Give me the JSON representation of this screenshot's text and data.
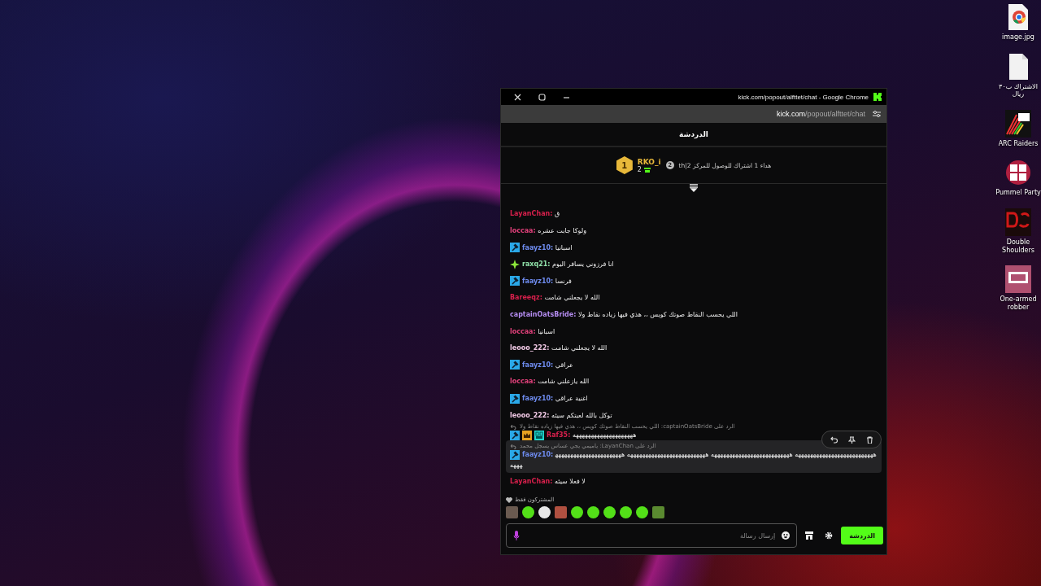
{
  "desktop_icons": [
    {
      "kind": "chrome-file",
      "label": "image.jpg"
    },
    {
      "kind": "blank-file",
      "label": "الاشتراك ب٣٠ ريال"
    },
    {
      "kind": "arc",
      "label": "ARC Raiders"
    },
    {
      "kind": "pummel",
      "label": "Pummel Party"
    },
    {
      "kind": "ds",
      "label": "Double Shoulders"
    },
    {
      "kind": "oar",
      "label": "One-armed robber"
    }
  ],
  "window": {
    "title": "kick.com/popout/alfttet/chat - Google Chrome",
    "url_host": "kick.com",
    "url_path": "/popout/alfttet/chat"
  },
  "chat": {
    "title": "الدردشة",
    "top_gifter": {
      "rank": "1",
      "name": "RKO_i",
      "gifts": "2",
      "next_rank_badge": "2",
      "next_rank_text": "th|هداء 1 اشتراك للوصول للمركز 2"
    },
    "messages": [
      {
        "user": "LayanChan:",
        "color": "#d8204c",
        "text": "ق",
        "highlighted": false
      },
      {
        "user": "loccaa:",
        "color": "#e0407a",
        "text": "ولوكا جابت عشره",
        "highlighted": false
      },
      {
        "user": "faayz10:",
        "color": "#6f8cf0",
        "badges": [
          {
            "kind": "mod"
          }
        ],
        "text": "اسبانيا",
        "highlighted": false
      },
      {
        "user": "raxq21:",
        "color": "#8fe0a8",
        "badges": [
          {
            "kind": "sparkle"
          }
        ],
        "text": "انا فرزوني يسافر اليوم",
        "highlighted": false
      },
      {
        "user": "faayz10:",
        "color": "#6f8cf0",
        "badges": [
          {
            "kind": "mod"
          }
        ],
        "text": "فرنسا",
        "highlighted": false
      },
      {
        "user": "Bareeqz:",
        "color": "#d8204c",
        "text": "الله لا يجعلني شامت",
        "highlighted": false
      },
      {
        "user": "captainOatsBride:",
        "color": "#b48cf0",
        "text": "اللي يحسب النقاط صوتك كويس ،، هذي فيها زياده نقاط ولا",
        "highlighted": false
      },
      {
        "user": "loccaa:",
        "color": "#e0407a",
        "text": "اسبانيا",
        "highlighted": false
      },
      {
        "user": "leooo_222:",
        "color": "#f0c8e4",
        "text": "الله لا يجعلني شامت",
        "highlighted": false
      },
      {
        "user": "faayz10:",
        "color": "#6f8cf0",
        "badges": [
          {
            "kind": "mod"
          }
        ],
        "text": "عراقي",
        "highlighted": false
      },
      {
        "user": "loccaa:",
        "color": "#e0407a",
        "text": "الله يازعلني شامت",
        "highlighted": false
      },
      {
        "user": "faayz10:",
        "color": "#6f8cf0",
        "badges": [
          {
            "kind": "mod"
          }
        ],
        "text": "اغنية عراقي",
        "highlighted": false
      },
      {
        "user": "leooo_222:",
        "color": "#f0c8e4",
        "text": "توكل بالله لعبتكم سيئه",
        "highlighted": false
      },
      {
        "user": "Raf35:",
        "color": "#d8204c",
        "badges": [
          {
            "kind": "mod"
          },
          {
            "kind": "crown"
          },
          {
            "kind": "og"
          }
        ],
        "reply_to": "الرد على captainOatsBride: اللي يحسب النقاط صوتك كويس ،، هذي فيها زياده نقاط ولا",
        "text": "ههههههههههههههههههههه",
        "highlighted": false
      },
      {
        "user": "faayz10:",
        "color": "#6f8cf0",
        "badges": [
          {
            "kind": "mod"
          }
        ],
        "reply_to": "الرد على LayanChan: ياميمي يجي عساس يسجل محمد",
        "text": "ههههههههههههههههههههههههههه ههههههههههههههههههههههههههه ههههههههههههههههههههههههههه ههههههههههههههههههههههههههه",
        "highlighted": true
      },
      {
        "user": "LayanChan:",
        "color": "#d8204c",
        "text": "لا فعلا سيئه",
        "highlighted": false
      }
    ],
    "emotes": {
      "label": "المشتركون فقط",
      "items": [
        {
          "kind": "face"
        },
        {
          "kind": "blob"
        },
        {
          "kind": "headset"
        },
        {
          "kind": "face2"
        },
        {
          "kind": "blob"
        },
        {
          "kind": "blob"
        },
        {
          "kind": "blob"
        },
        {
          "kind": "blob"
        },
        {
          "kind": "blob"
        },
        {
          "kind": "box"
        }
      ]
    },
    "input": {
      "placeholder": "إرسال رسالة"
    },
    "send_button": "الدردشة"
  }
}
